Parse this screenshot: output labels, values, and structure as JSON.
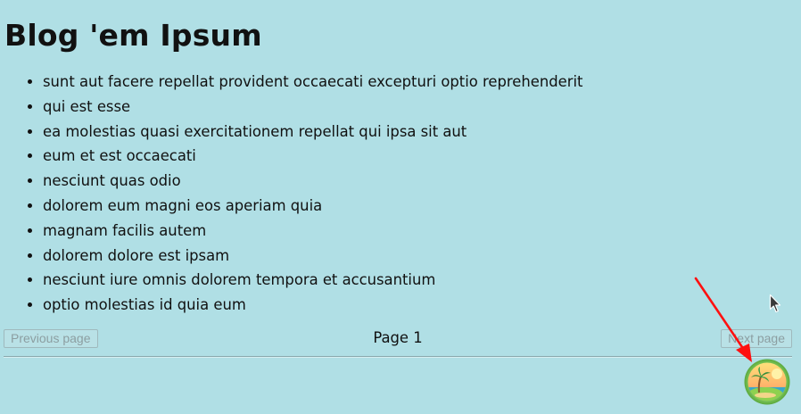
{
  "blog": {
    "title": "Blog 'em Ipsum",
    "posts": [
      "sunt aut facere repellat provident occaecati excepturi optio reprehenderit",
      "qui est esse",
      "ea molestias quasi exercitationem repellat qui ipsa sit aut",
      "eum et est occaecati",
      "nesciunt quas odio",
      "dolorem eum magni eos aperiam quia",
      "magnam facilis autem",
      "dolorem dolore est ipsam",
      "nesciunt iure omnis dolorem tempora et accusantium",
      "optio molestias id quia eum"
    ]
  },
  "pagination": {
    "previous_label": "Previous page",
    "next_label": "Next page",
    "page_label": "Page 1",
    "previous_disabled": true,
    "next_disabled": true
  },
  "devtools_icon": {
    "icon": "palm-tree-island-icon"
  },
  "colors": {
    "background": "#b0dfe5",
    "annotation_arrow": "#ff0000"
  }
}
